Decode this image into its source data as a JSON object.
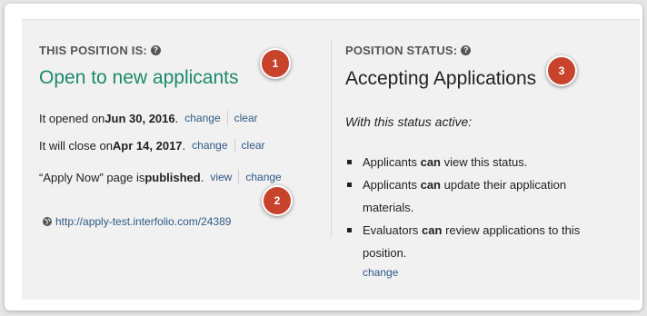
{
  "left": {
    "heading": "THIS POSITION IS:",
    "status": "Open to new applicants",
    "opened": {
      "prefix": "It opened on ",
      "date": "Jun 30, 2016",
      "suffix": ".",
      "change": "change",
      "clear": "clear"
    },
    "closes": {
      "prefix": "It will close on ",
      "date": "Apr 14, 2017",
      "suffix": ".",
      "change": "change",
      "clear": "clear"
    },
    "apply_page": {
      "prefix": "“Apply Now” page is ",
      "state": "published",
      "suffix": " .",
      "view": "view",
      "change": "change"
    },
    "url": "http://apply-test.interfolio.com/24389"
  },
  "right": {
    "heading": "POSITION STATUS:",
    "status": "Accepting Applications",
    "subheading": "With this status active:",
    "items": [
      {
        "pre": "Applicants ",
        "bold": "can",
        "post": " view this status."
      },
      {
        "pre": "Applicants ",
        "bold": "can",
        "post": " update their application materials."
      },
      {
        "pre": "Evaluators ",
        "bold": "can",
        "post": " review applications to this position."
      }
    ],
    "change": "change"
  },
  "callouts": [
    "1",
    "2",
    "3"
  ],
  "colors": {
    "accent_green": "#1a8a6a",
    "link": "#2f5a87",
    "callout": "#c8432c"
  },
  "icons": {
    "help": "question-circle-icon",
    "globe": "globe-icon"
  }
}
